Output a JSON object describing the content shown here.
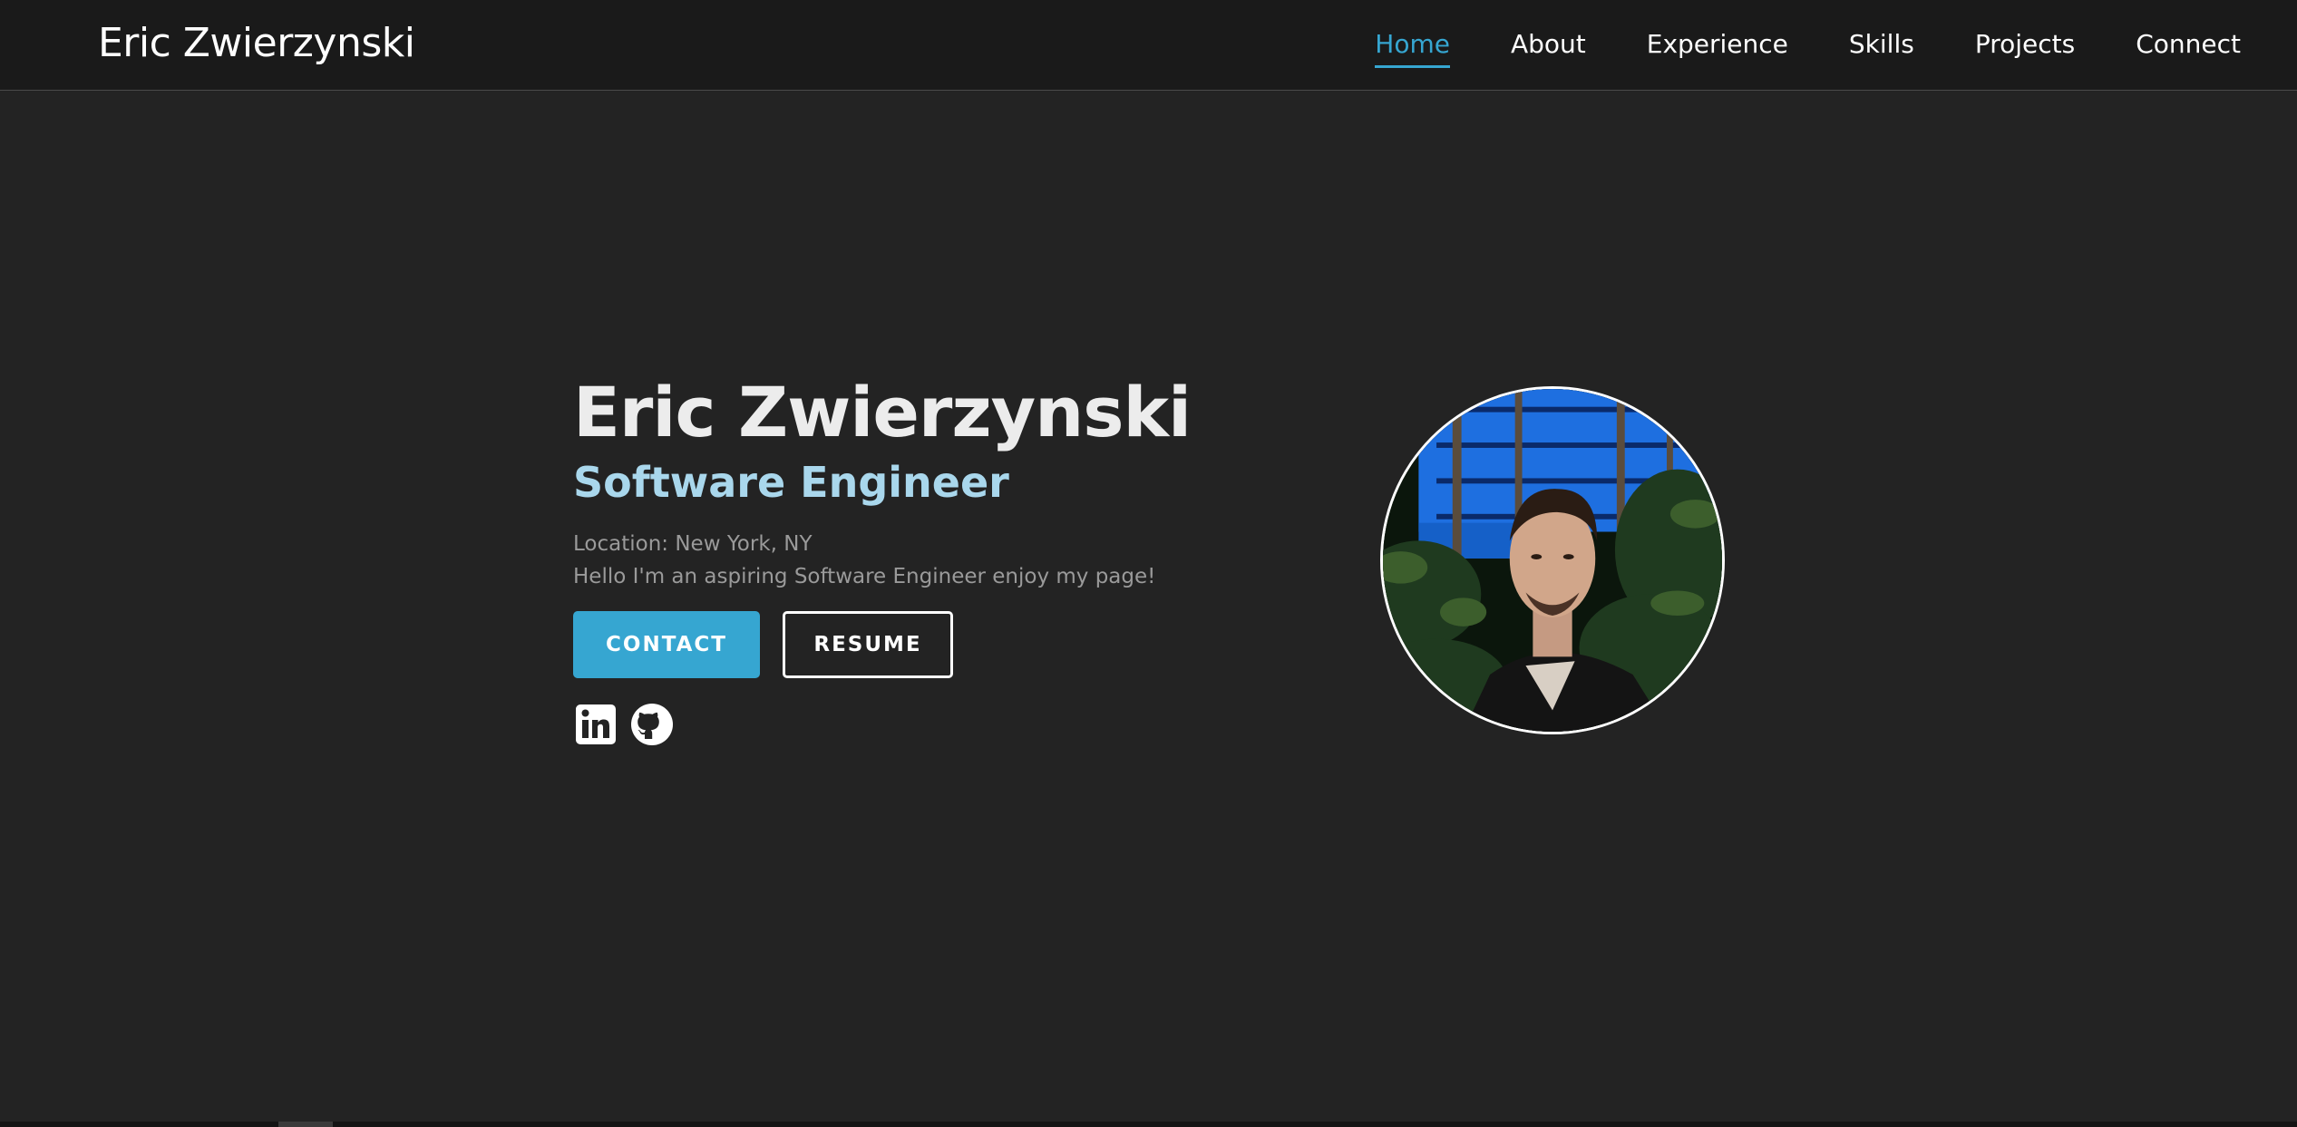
{
  "navbar": {
    "brand": "Eric Zwierzynski",
    "links": [
      {
        "label": "Home",
        "active": true
      },
      {
        "label": "About"
      },
      {
        "label": "Experience"
      },
      {
        "label": "Skills"
      },
      {
        "label": "Projects"
      },
      {
        "label": "Connect"
      }
    ]
  },
  "hero": {
    "name": "Eric Zwierzynski",
    "title": "Software Engineer",
    "location": "Location: New York, NY",
    "bio": "Hello I'm an aspiring Software Engineer enjoy my page!",
    "contact_label": "CONTACT",
    "resume_label": "RESUME",
    "socials": [
      {
        "icon": "linkedin-icon"
      },
      {
        "icon": "github-icon"
      }
    ]
  },
  "colors": {
    "background": "#232323",
    "navbar": "#1a1a1a",
    "accent": "#36a6d1",
    "subtitle": "#a9d7ec",
    "muted_text": "#9a9a9a"
  }
}
